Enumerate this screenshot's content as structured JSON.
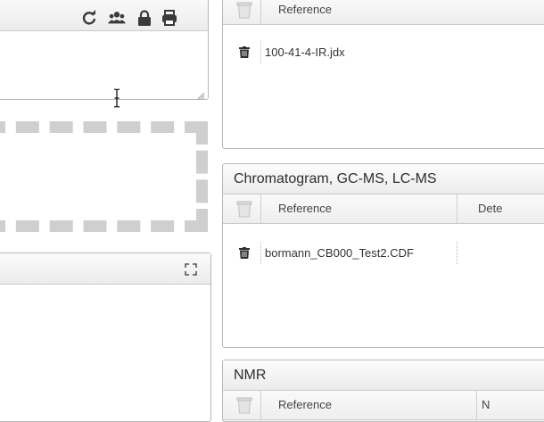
{
  "ir_panel": {
    "columns": {
      "reference": "Reference"
    },
    "rows": [
      {
        "reference": "100-41-4-IR.jdx"
      }
    ]
  },
  "chrom_panel": {
    "title": "Chromatogram, GC-MS, LC-MS",
    "columns": {
      "reference": "Reference",
      "details": "Dete"
    },
    "rows": [
      {
        "reference": "bormann_CB000_Test2.CDF"
      }
    ]
  },
  "nmr_panel": {
    "title": "NMR",
    "columns": {
      "reference": "Reference",
      "second": "N"
    }
  },
  "icons": {
    "editor_toolbar": [
      "refresh-icon",
      "users-icon",
      "lock-icon",
      "print-icon"
    ],
    "viewer_toolbar": [
      "fullscreen-icon"
    ]
  },
  "colors": {
    "border": "#b9b9b9",
    "dropzone": "#cfcfcf",
    "icon": "#3a3a3a"
  }
}
